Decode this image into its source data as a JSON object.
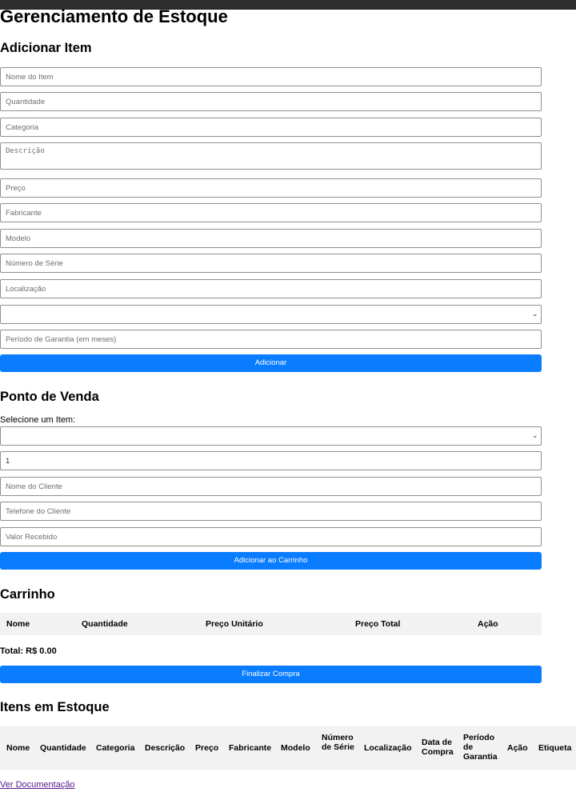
{
  "title": "Gerenciamento de Estoque",
  "add_item": {
    "heading": "Adicionar Item",
    "name_placeholder": "Nome do Item",
    "quantity_placeholder": "Quantidade",
    "category_placeholder": "Categoria",
    "description_placeholder": "Descrição",
    "price_placeholder": "Preço",
    "manufacturer_placeholder": "Fabricante",
    "model_placeholder": "Modelo",
    "serial_placeholder": "Número de Série",
    "location_placeholder": "Localização",
    "date_value": "",
    "warranty_placeholder": "Período de Garantia (em meses)",
    "submit_label": "Adicionar"
  },
  "pos": {
    "heading": "Ponto de Venda",
    "select_label": "Selecione um Item:",
    "select_value": "",
    "quantity_value": "1",
    "customer_name_placeholder": "Nome do Cliente",
    "customer_phone_placeholder": "Telefone do Cliente",
    "amount_received_placeholder": "Valor Recebido",
    "add_to_cart_label": "Adicionar ao Carrinho"
  },
  "cart": {
    "heading": "Carrinho",
    "columns": [
      "Nome",
      "Quantidade",
      "Preço Unitário",
      "Preço Total",
      "Ação"
    ],
    "total_text": "Total: R$ 0.00",
    "checkout_label": "Finalizar Compra"
  },
  "stock": {
    "heading": "Itens em Estoque",
    "columns": [
      "Nome",
      "Quantidade",
      "Categoria",
      "Descrição",
      "Preço",
      "Fabricante",
      "Modelo",
      "Número de Série",
      "Localização",
      "Data de Compra",
      "Período de Garantia",
      "Ação",
      "Etiqueta"
    ]
  },
  "doc_link": "Ver Documentação",
  "icons": {
    "select_chevron": "chevron-down-icon"
  },
  "colors": {
    "primary_button": "#0a7cff",
    "header_bg": "#f2f2f2",
    "topbar": "#2e2e2e"
  }
}
